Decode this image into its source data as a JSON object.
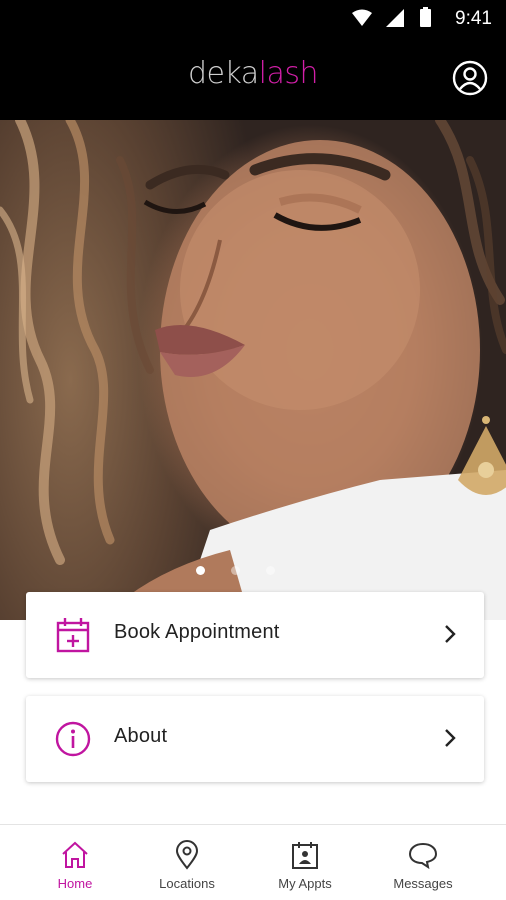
{
  "status_bar": {
    "time": "9:41"
  },
  "header": {
    "logo_part1": "deka",
    "logo_part2": "lash",
    "profile_icon": "user-circle-icon"
  },
  "carousel": {
    "pages": 3,
    "active_index": 0
  },
  "menu": [
    {
      "label": "Book Appointment",
      "icon": "calendar-plus-icon"
    },
    {
      "label": "About",
      "icon": "info-icon"
    }
  ],
  "bottom_nav": {
    "items": [
      {
        "label": "Home",
        "icon": "home-icon",
        "active": true
      },
      {
        "label": "Locations",
        "icon": "location-pin-icon",
        "active": false
      },
      {
        "label": "My Appts",
        "icon": "calendar-person-icon",
        "active": false
      },
      {
        "label": "Messages",
        "icon": "chat-bubble-icon",
        "active": false
      }
    ]
  },
  "colors": {
    "accent": "#C015A0",
    "logo_grey": "#CFCFCF",
    "header_bg": "#000000"
  }
}
